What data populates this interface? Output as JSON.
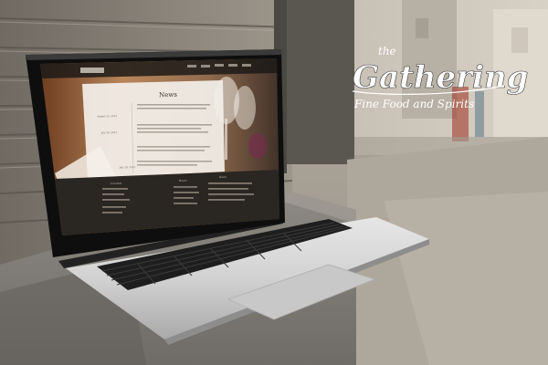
{
  "logo": {
    "top_word": "the",
    "name": "Gathering",
    "tagline": "Fine Food and Spirits"
  },
  "site": {
    "heading": "News",
    "news_dates": [
      "August 15, 2013",
      "July 30, 2013",
      "July 28, 2013"
    ],
    "footer_headings": [
      "Location",
      "Hours",
      "News"
    ]
  },
  "colors": {
    "page_bg": "#f3efe9",
    "footer_bg": "#2a2622",
    "logo_text": "#ffffff"
  }
}
